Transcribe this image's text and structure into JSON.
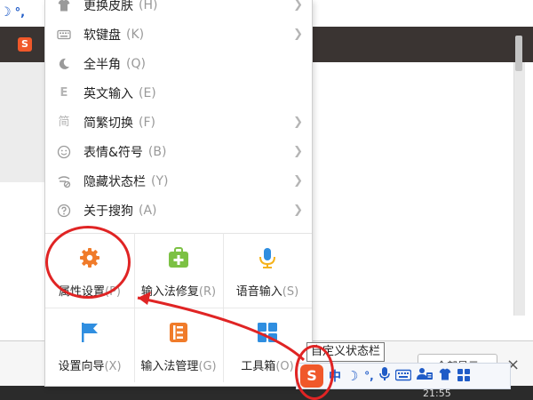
{
  "menu": {
    "items": [
      {
        "icon": "shirt-icon",
        "label": "更换皮肤",
        "key": "(H)"
      },
      {
        "icon": "keyboard-icon",
        "label": "软键盘",
        "key": "(K)"
      },
      {
        "icon": "moon-icon",
        "label": "全半角",
        "key": "(Q)"
      },
      {
        "icon": "english-e-icon",
        "label": "英文输入",
        "key": "(E)"
      },
      {
        "icon": "jian-char-icon",
        "label": "简繁切换",
        "key": "(F)"
      },
      {
        "icon": "smiley-icon",
        "label": "表情&符号",
        "key": "(B)"
      },
      {
        "icon": "hide-statusbar-icon",
        "label": "隐藏状态栏",
        "key": "(Y)"
      },
      {
        "icon": "help-icon",
        "label": "关于搜狗",
        "key": "(A)"
      }
    ],
    "tiles": [
      {
        "icon": "gear-icon",
        "label": "属性设置",
        "key": "(P)",
        "color": "#f07b2a"
      },
      {
        "icon": "repair-kit-icon",
        "label": "输入法修复",
        "key": "(R)",
        "color": "#7cc144"
      },
      {
        "icon": "microphone-icon",
        "label": "语音输入",
        "key": "(S)",
        "color": "#2f8ee0"
      },
      {
        "icon": "flag-icon",
        "label": "设置向导",
        "key": "(X)",
        "color": "#2f8ee0"
      },
      {
        "icon": "ime-manager-icon",
        "label": "输入法管理",
        "key": "(G)",
        "color": "#f07b2a"
      },
      {
        "icon": "grid-icon",
        "label": "工具箱",
        "key": "(O)",
        "color": "#2f8ee0"
      }
    ]
  },
  "tooltip": {
    "text": "自定义状态栏"
  },
  "statusbar": {
    "logo": "S",
    "mode": "中",
    "punct": "°,",
    "items": [
      "keyboard",
      "mic",
      "keyboard2",
      "user",
      "shirt",
      "grid"
    ]
  },
  "background": {
    "show_all": "全部显示",
    "clock": "21:55",
    "close": "×",
    "mini_mode": "°,"
  },
  "colors": {
    "accent_red": "#e02424",
    "ime_blue": "#1f5bc7",
    "brand_orange": "#f0582a"
  }
}
